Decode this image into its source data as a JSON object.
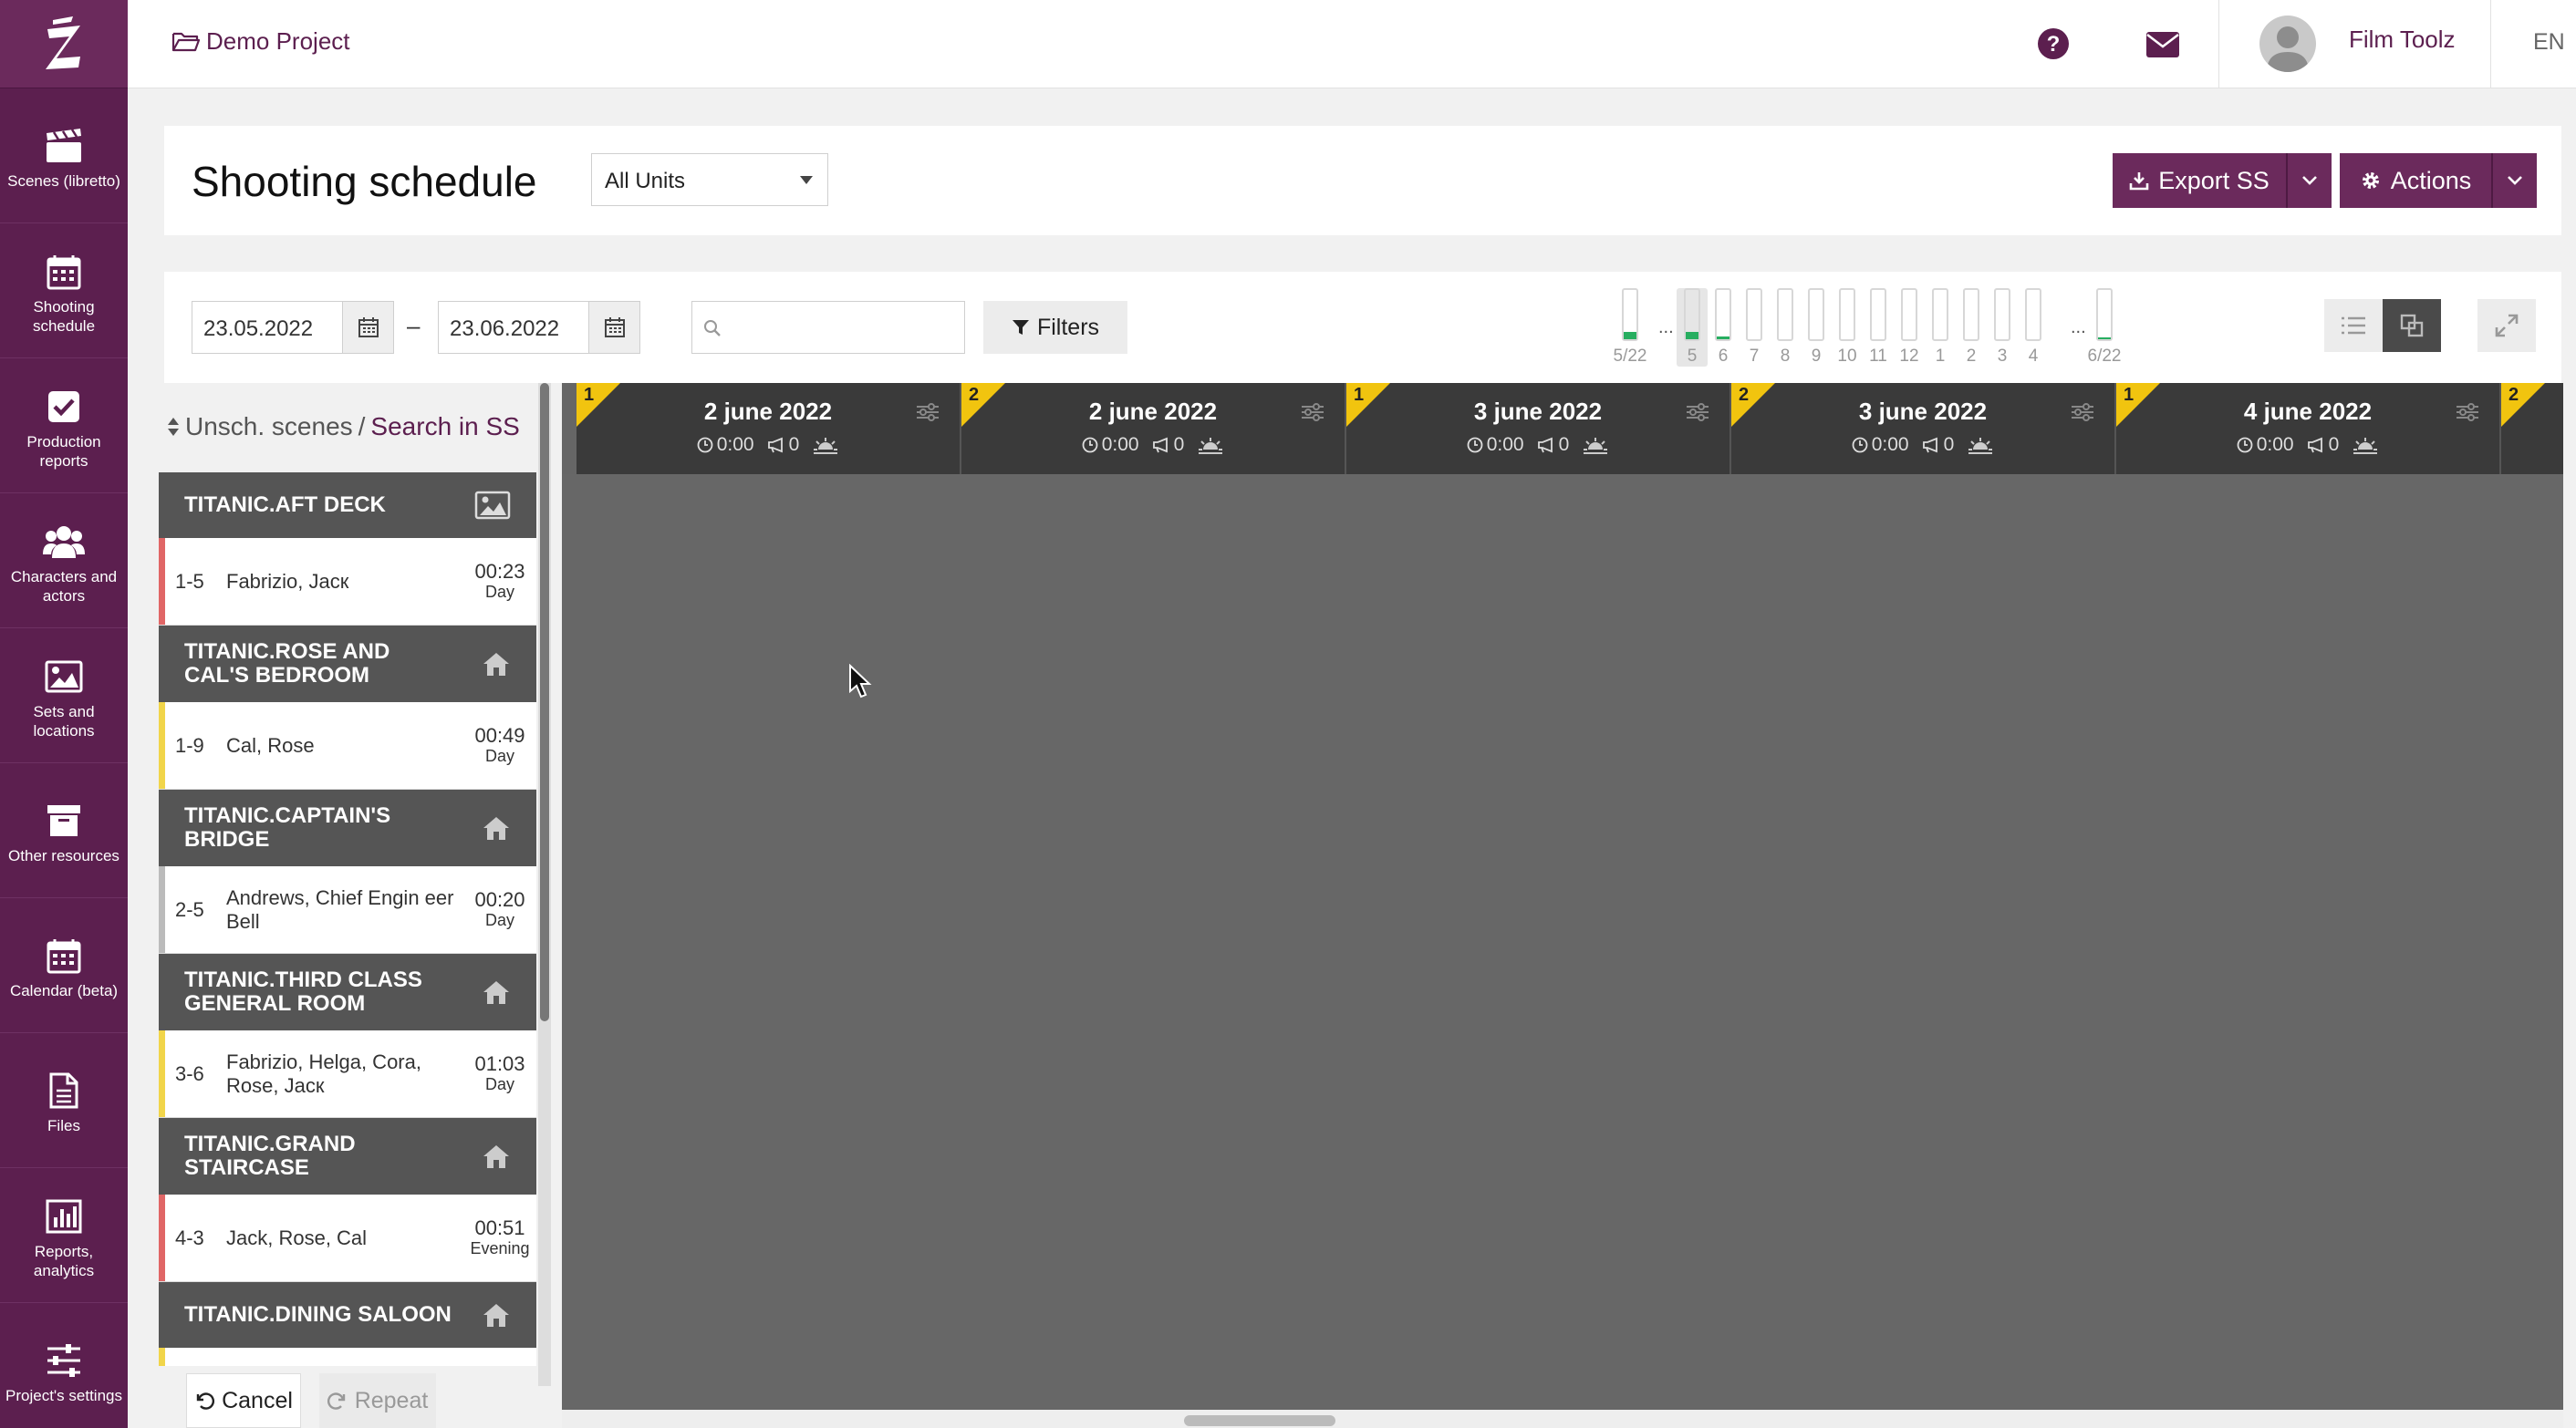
{
  "sidebar": {
    "items": [
      {
        "label": "Scenes (libretto)",
        "icon": "clapperboard-icon"
      },
      {
        "label": "Shooting schedule",
        "icon": "calendar-grid-icon"
      },
      {
        "label": "Production reports",
        "icon": "checkbox-icon"
      },
      {
        "label": "Characters and actors",
        "icon": "users-icon"
      },
      {
        "label": "Sets and locations",
        "icon": "image-icon"
      },
      {
        "label": "Other resources",
        "icon": "archive-icon"
      },
      {
        "label": "Calendar (beta)",
        "icon": "calendar-icon"
      },
      {
        "label": "Files",
        "icon": "file-icon"
      },
      {
        "label": "Reports, analytics",
        "icon": "bar-chart-icon"
      },
      {
        "label": "Project's settings",
        "icon": "sliders-icon"
      }
    ]
  },
  "topbar": {
    "project": "Demo Project",
    "user_name": "Film Toolz",
    "language": "EN"
  },
  "header": {
    "title": "Shooting schedule",
    "unit_select": "All Units",
    "export_label": "Export SS",
    "actions_label": "Actions"
  },
  "toolbar": {
    "date_from": "23.05.2022",
    "date_to": "23.06.2022",
    "search_placeholder": "",
    "filters_label": "Filters",
    "day_bars": [
      {
        "label": "5/22",
        "fill": 0.15,
        "active": false
      },
      {
        "label": "5",
        "fill": 0.15,
        "active": true
      },
      {
        "label": "6",
        "fill": 0.05,
        "active": false
      },
      {
        "label": "7",
        "fill": 0,
        "active": false
      },
      {
        "label": "8",
        "fill": 0,
        "active": false
      },
      {
        "label": "9",
        "fill": 0,
        "active": false
      },
      {
        "label": "10",
        "fill": 0,
        "active": false
      },
      {
        "label": "11",
        "fill": 0,
        "active": false
      },
      {
        "label": "12",
        "fill": 0,
        "active": false
      },
      {
        "label": "1",
        "fill": 0,
        "active": false
      },
      {
        "label": "2",
        "fill": 0,
        "active": false
      },
      {
        "label": "3",
        "fill": 0,
        "active": false
      },
      {
        "label": "4",
        "fill": 0,
        "active": false
      },
      {
        "label": "6/22",
        "fill": 0.04,
        "active": false
      }
    ],
    "ellipsis": "..."
  },
  "scenes_panel": {
    "heading": "Unsch. scenes",
    "separator": "/",
    "search_link": "Search in SS",
    "cancel_label": "Cancel",
    "repeat_label": "Repeat",
    "groups": [
      {
        "set": "TITANIC.AFT DECK",
        "icon": "image-icon",
        "scenes": [
          {
            "num": "1-5",
            "actors": "Fabrizio, Jacк",
            "time": "00:23",
            "tod": "Day",
            "color": "#e06666"
          }
        ]
      },
      {
        "set": "TITANIC.ROSE AND CAL'S BEDROOM",
        "icon": "home-icon",
        "scenes": [
          {
            "num": "1-9",
            "actors": "Cal, Rose",
            "time": "00:49",
            "tod": "Day",
            "color": "#f1d54a"
          }
        ]
      },
      {
        "set": "TITANIC.CAPTAIN'S BRIDGE",
        "icon": "home-icon",
        "scenes": [
          {
            "num": "2-5",
            "actors": "Andrews, Chief Engin eer Bell",
            "time": "00:20",
            "tod": "Day",
            "color": "#bbbbbb"
          }
        ]
      },
      {
        "set": "TITANIC.THIRD CLASS GENERAL ROOM",
        "icon": "home-icon",
        "scenes": [
          {
            "num": "3-6",
            "actors": "Fabrizio, Helga, Cora, Rose, Jacк",
            "time": "01:03",
            "tod": "Day",
            "color": "#f1d54a"
          }
        ]
      },
      {
        "set": "TITANIC.GRAND STAIRCASE",
        "icon": "home-icon",
        "scenes": [
          {
            "num": "4-3",
            "actors": "Jack, Rose, Cal",
            "time": "00:51",
            "tod": "Evening",
            "color": "#e06666"
          }
        ]
      },
      {
        "set": "TITANIC.DINING SALOON",
        "icon": "home-icon",
        "scenes": []
      }
    ]
  },
  "board": {
    "days": [
      {
        "unit": "1",
        "title": "2 june 2022",
        "time": "0:00",
        "count": "0"
      },
      {
        "unit": "2",
        "title": "2 june 2022",
        "time": "0:00",
        "count": "0"
      },
      {
        "unit": "1",
        "title": "3 june 2022",
        "time": "0:00",
        "count": "0"
      },
      {
        "unit": "2",
        "title": "3 june 2022",
        "time": "0:00",
        "count": "0"
      },
      {
        "unit": "1",
        "title": "4 june 2022",
        "time": "0:00",
        "count": "0"
      },
      {
        "unit": "2",
        "title": "",
        "time": "",
        "count": ""
      }
    ]
  },
  "colors": {
    "brand": "#5c1f4f",
    "button": "#6b2a5c",
    "board_bg": "#676767",
    "unit_badge": "#f1c40f",
    "day_bar_fill": "#27ae60"
  }
}
